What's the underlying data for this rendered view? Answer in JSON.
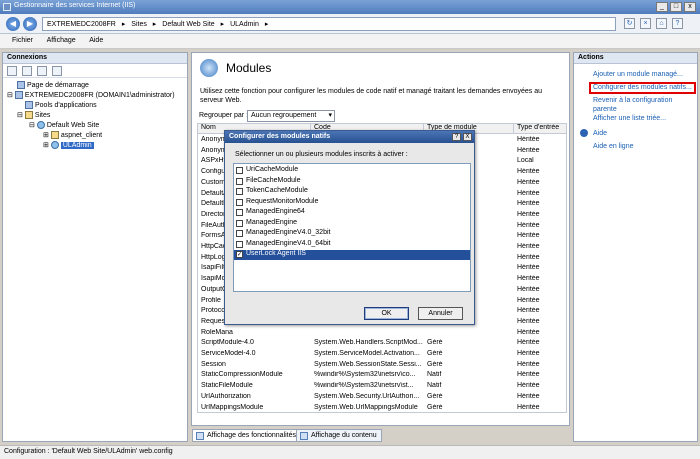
{
  "window": {
    "title": "Gestionnaire des services Internet (IIS)"
  },
  "address": {
    "path": [
      "EXTREMEDC2008FR",
      "▸",
      "Sites",
      "▸",
      "Default Web Site",
      "▸",
      "ULAdmin",
      "▸"
    ]
  },
  "menu": {
    "file": "Fichier",
    "view": "Affichage",
    "help": "Aide"
  },
  "connections": {
    "title": "Connexions",
    "tree": [
      "Page de démarrage",
      "EXTREMEDC2008FR (DOMAIN1\\administrator)",
      "Pools d'applications",
      "Sites",
      "Default Web Site",
      "aspnet_client",
      "ULAdmin"
    ]
  },
  "main": {
    "title": "Modules",
    "description": "Utilisez cette fonction pour configurer les modules de code natif et managé traitant les demandes envoyées au serveur Web.",
    "group_label": "Regrouper par :",
    "group_value": "Aucun regroupement",
    "columns": [
      "Nom",
      "Code",
      "Type de module",
      "Type d'entrée"
    ],
    "rows": [
      [
        "Anonym",
        "",
        "",
        "Héritée"
      ],
      [
        "Anonym",
        "",
        "",
        "Héritée"
      ],
      [
        "ASPxHtt",
        "",
        "",
        "Local"
      ],
      [
        "Configur",
        "",
        "",
        "Héritée"
      ],
      [
        "CustomE",
        "",
        "",
        "Héritée"
      ],
      [
        "DefaultA",
        "",
        "",
        "Héritée"
      ],
      [
        "DefaultD",
        "",
        "",
        "Héritée"
      ],
      [
        "Director",
        "",
        "",
        "Héritée"
      ],
      [
        "FileAuth",
        "",
        "",
        "Héritée"
      ],
      [
        "FormsAu",
        "",
        "",
        "Héritée"
      ],
      [
        "HttpCac",
        "",
        "",
        "Héritée"
      ],
      [
        "HttpLog",
        "",
        "",
        "Héritée"
      ],
      [
        "IsapiFilt",
        "",
        "",
        "Héritée"
      ],
      [
        "IsapiMo",
        "",
        "",
        "Héritée"
      ],
      [
        "OutputC",
        "",
        "",
        "Héritée"
      ],
      [
        "Profile",
        "",
        "",
        "Héritée"
      ],
      [
        "Protocol",
        "",
        "",
        "Héritée"
      ],
      [
        "Request",
        "",
        "",
        "Héritée"
      ],
      [
        "RoleMana",
        "",
        "",
        "Héritée"
      ],
      [
        "ScriptModule-4.0",
        "System.Web.Handlers.ScriptMod...",
        "Géré",
        "Héritée"
      ],
      [
        "ServiceModel-4.0",
        "System.ServiceModel.Activation...",
        "Géré",
        "Héritée"
      ],
      [
        "Session",
        "System.Web.SessionState.Sessi...",
        "Géré",
        "Héritée"
      ],
      [
        "StaticCompressionModule",
        "%windir%\\System32\\inetsrv\\co...",
        "Natif",
        "Héritée"
      ],
      [
        "StaticFileModule",
        "%windir%\\System32\\inetsrv\\st...",
        "Natif",
        "Héritée"
      ],
      [
        "UrlAuthorization",
        "System.Web.Security.UrlAuthori...",
        "Géré",
        "Héritée"
      ],
      [
        "UrlMappingsModule",
        "System.Web.UrlMappingsModule",
        "Géré",
        "Héritée"
      ]
    ],
    "tabs": [
      "Affichage des fonctionnalités",
      "Affichage du contenu"
    ]
  },
  "actions": {
    "title": "Actions",
    "items": [
      "Ajouter un module managé...",
      "Configurer des modules natifs...",
      "Revenir à la configuration parente",
      "Afficher une liste triée...",
      "Aide",
      "Aide en ligne"
    ]
  },
  "dialog": {
    "title": "Configurer des modules natifs",
    "help_btn": "?",
    "close_btn": "X",
    "label": "Sélectionner un ou plusieurs modules inscrits à activer :",
    "modules": [
      {
        "name": "UriCacheModule",
        "checked": false
      },
      {
        "name": "FileCacheModule",
        "checked": false
      },
      {
        "name": "TokenCacheModule",
        "checked": false
      },
      {
        "name": "RequestMonitorModule",
        "checked": false
      },
      {
        "name": "ManagedEngine64",
        "checked": false
      },
      {
        "name": "ManagedEngine",
        "checked": false
      },
      {
        "name": "ManagedEngineV4.0_32bit",
        "checked": false
      },
      {
        "name": "ManagedEngineV4.0_64bit",
        "checked": false
      },
      {
        "name": "UserLock Agent IIS",
        "checked": true
      }
    ],
    "ok": "OK",
    "cancel": "Annuler"
  },
  "status": {
    "text": "Configuration : 'Default Web Site/ULAdmin' web.config"
  }
}
